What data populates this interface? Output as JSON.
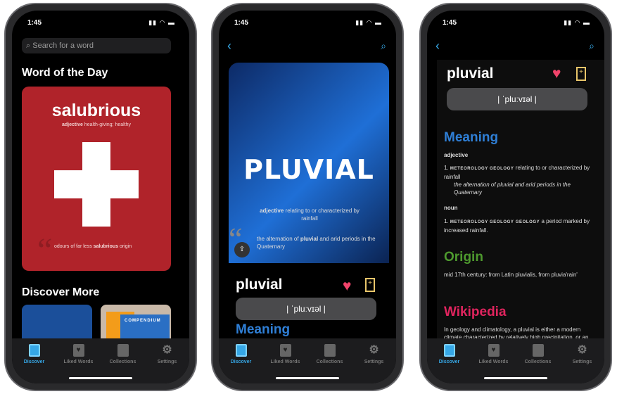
{
  "status": {
    "time": "1:45"
  },
  "tabs": [
    {
      "label": "Discover",
      "icon": "discover-icon"
    },
    {
      "label": "Liked Words",
      "icon": "heart-icon"
    },
    {
      "label": "Collections",
      "icon": "bookmark-icon"
    },
    {
      "label": "Settings",
      "icon": "gear-icon"
    }
  ],
  "discover": {
    "search_placeholder": "Search for a word",
    "wotd_heading": "Word of the Day",
    "wotd": {
      "word": "salubrious",
      "pos": "adjective",
      "definition": "health-giving; healthy",
      "quote_pre": "odours of far less ",
      "quote_word": "salubrious",
      "quote_post": " origin",
      "color": "#b0232a"
    },
    "discover_heading": "Discover More",
    "card2_title": "COMPENDIUM"
  },
  "detail": {
    "card": {
      "title": "PLUVIAL",
      "pos": "adjective",
      "definition": "relating to or characterized by rainfall",
      "quote_pre": "the alternation of ",
      "quote_word": "pluvial",
      "quote_post": " and arid periods in the Quaternary"
    },
    "word": "pluvial",
    "pronunciation": "| ˈpluːvɪəl |",
    "partial_heading": "Meaning"
  },
  "entry": {
    "word": "pluvial",
    "pronunciation": "| ˈpluːvɪəl |",
    "meaning_heading": "Meaning",
    "meaning_color": "#2f7fd6",
    "adj_label": "adjective",
    "adj_num": "1.",
    "adj_tags": "METEOROLOGY GEOLOGY",
    "adj_def": "relating to or characterized by rainfall",
    "adj_example": "the alternation of pluvial and arid periods in the Quaternary",
    "noun_label": "noun",
    "noun_num": "1.",
    "noun_tags": "METEOROLOGY GEOLOGY GEOLOGY",
    "noun_def": "a period marked by increased rainfall.",
    "origin_heading": "Origin",
    "origin_color": "#4e9a2e",
    "origin_text": "mid 17th century: from Latin pluvialis, from pluvia'rain'",
    "wiki_heading": "Wikipedia",
    "wiki_color": "#e0245e",
    "wiki_text": "In geology and climatology, a pluvial is either a modern climate characterized by relatively high precipitation, or an interval of time of variable"
  },
  "colors": {
    "accent": "#36a7e6",
    "heart": "#f0436a",
    "bookmark": "#e8c56a"
  }
}
